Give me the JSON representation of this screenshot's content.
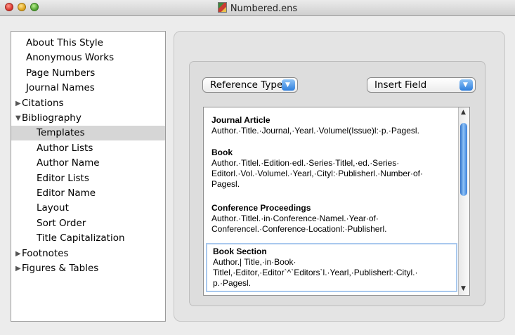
{
  "window": {
    "title": "Numbered.ens"
  },
  "sidebar": {
    "items": [
      {
        "label": "About This Style",
        "indent": 0,
        "disclosure": "",
        "selected": false
      },
      {
        "label": "Anonymous Works",
        "indent": 0,
        "disclosure": "",
        "selected": false
      },
      {
        "label": "Page Numbers",
        "indent": 0,
        "disclosure": "",
        "selected": false
      },
      {
        "label": "Journal Names",
        "indent": 0,
        "disclosure": "",
        "selected": false
      },
      {
        "label": "Citations",
        "indent": 0,
        "disclosure": "collapsed",
        "selected": false
      },
      {
        "label": "Bibliography",
        "indent": 0,
        "disclosure": "expanded",
        "selected": false
      },
      {
        "label": "Templates",
        "indent": 1,
        "disclosure": "",
        "selected": true
      },
      {
        "label": "Author Lists",
        "indent": 1,
        "disclosure": "",
        "selected": false
      },
      {
        "label": "Author Name",
        "indent": 1,
        "disclosure": "",
        "selected": false
      },
      {
        "label": "Editor Lists",
        "indent": 1,
        "disclosure": "",
        "selected": false
      },
      {
        "label": "Editor Name",
        "indent": 1,
        "disclosure": "",
        "selected": false
      },
      {
        "label": "Layout",
        "indent": 1,
        "disclosure": "",
        "selected": false
      },
      {
        "label": "Sort Order",
        "indent": 1,
        "disclosure": "",
        "selected": false
      },
      {
        "label": "Title Capitalization",
        "indent": 1,
        "disclosure": "",
        "selected": false
      },
      {
        "label": "Footnotes",
        "indent": 0,
        "disclosure": "collapsed",
        "selected": false
      },
      {
        "label": "Figures & Tables",
        "indent": 0,
        "disclosure": "collapsed",
        "selected": false
      }
    ]
  },
  "toolbar": {
    "reference_types_label": "Reference Types",
    "insert_field_label": "Insert Field"
  },
  "templates": [
    {
      "title": "Journal Article",
      "body": "Author.·Title.·Journal,·Yearl.·Volumel(Issue)l:·p.·Pagesl.",
      "selected": false
    },
    {
      "title": "Book",
      "body": "Author.·Titlel.·Edition·edl.·Series·Titlel,·ed.·Series·\nEditorl.·Vol.·Volumel.·Yearl,·Cityl:·Publisherl.·Number·of·\nPagesl.",
      "selected": false
    },
    {
      "title": "Conference Proceedings",
      "body": "Author.·Titlel.·in·Conference·Namel.·Year·of·\nConferencel.·Conference·Locationl:·Publisherl.",
      "selected": false
    },
    {
      "title": "Book Section",
      "body": "Author.| Title,·in·Book·\nTitlel,·Editor,·Editor`^`Editors`l.·Yearl,·Publisherl:·Cityl.·\np.·Pagesl.",
      "selected": true
    }
  ],
  "icons": {
    "disclosure_collapsed": "triangle-right-icon",
    "disclosure_expanded": "triangle-down-icon",
    "popup_arrow": "chevron-down-icon"
  },
  "colors": {
    "selection_gray": "#d6d6d6",
    "accent_blue": "#3a80db"
  }
}
